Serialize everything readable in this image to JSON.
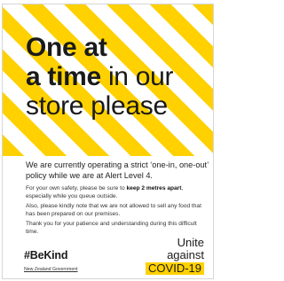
{
  "headline": {
    "line1": "One at",
    "line2_bold": "a time",
    "line2_rest": " in our",
    "line3": "store please"
  },
  "lead": "We are currently operating a strict ‘one-in, one-out’ policy while we are at Alert Level 4.",
  "para1": {
    "before": "For your own safety, please be sure to ",
    "bold": "keep 2 metres apart",
    "after": ", especially while you queue outside."
  },
  "para2": "Also, please kindly note that we are not allowed to sell any food that has been prepared on our premises.",
  "para3": "Thank you for your patience and understanding during this difficult time.",
  "hashtag": "#BeKind",
  "govt": "New Zealand Government",
  "logo": {
    "line1": "Unite",
    "line2": "against",
    "line3": "COVID-19"
  },
  "colors": {
    "accent": "#ffd100",
    "text": "#1a1a1a"
  }
}
